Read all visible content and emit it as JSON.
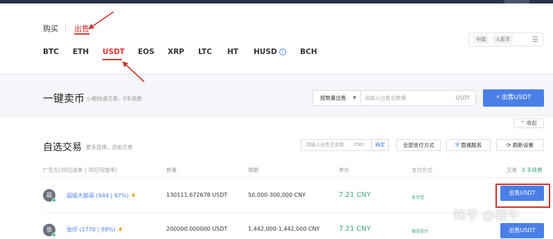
{
  "tabs": {
    "buy": "购买",
    "sell": "出售"
  },
  "coins": [
    "BTC",
    "ETH",
    "USDT",
    "EOS",
    "XRP",
    "LTC",
    "HT",
    "HUSD",
    "BCH"
  ],
  "coin_active": "USDT",
  "region_filter": {
    "country": "中国",
    "currency": "人民币",
    "icon": "menu-icon"
  },
  "quick_sell": {
    "title": "一键卖币",
    "subtitle": "小额快速交易，0手续费",
    "mode_select": "按数量出售",
    "placeholder": "请输入出售总数量",
    "unit": "USDT",
    "button": "出售USDT"
  },
  "collapse_label": "收起",
  "optional": {
    "title": "自选交易",
    "subtitle": "更多选择，自由交易",
    "amount_placeholder": "请输入出售总金额",
    "amount_unit": "CNY",
    "confirm": "确定",
    "pay_methods": "全部支付方式",
    "escrow": "盾福服务",
    "refresh": "刷新设置"
  },
  "table": {
    "headers": {
      "advertiser": "广告方(30日成单 | 30日完成率)",
      "quantity": "数量",
      "limit": "限额",
      "price": "单价",
      "payment": "支付方式",
      "trade": "交易",
      "fee": "0 手续费"
    },
    "rows": [
      {
        "avatar": "超",
        "trader": "超级大脑哥 (944 | 97%)",
        "quantity": "130111.672678 USDT",
        "limit": "50,000-300,000 CNY",
        "price": "7.21 CNY",
        "payment": "支付宝",
        "action": "出售USDT"
      },
      {
        "avatar": "张",
        "trader": "张仔 (1770 | 98%)",
        "quantity": "200000.000000 USDT",
        "limit": "1,442,000-1,442,000 CNY",
        "price": "7.21 CNY",
        "payment": "微信支付",
        "action": "出售USDT"
      }
    ]
  },
  "watermark": "知乎 @程牛",
  "colors": {
    "accent": "#4b7fe8",
    "sell_red": "#e0332e",
    "price_green": "#3aa573",
    "annotation": "#c8342e"
  }
}
